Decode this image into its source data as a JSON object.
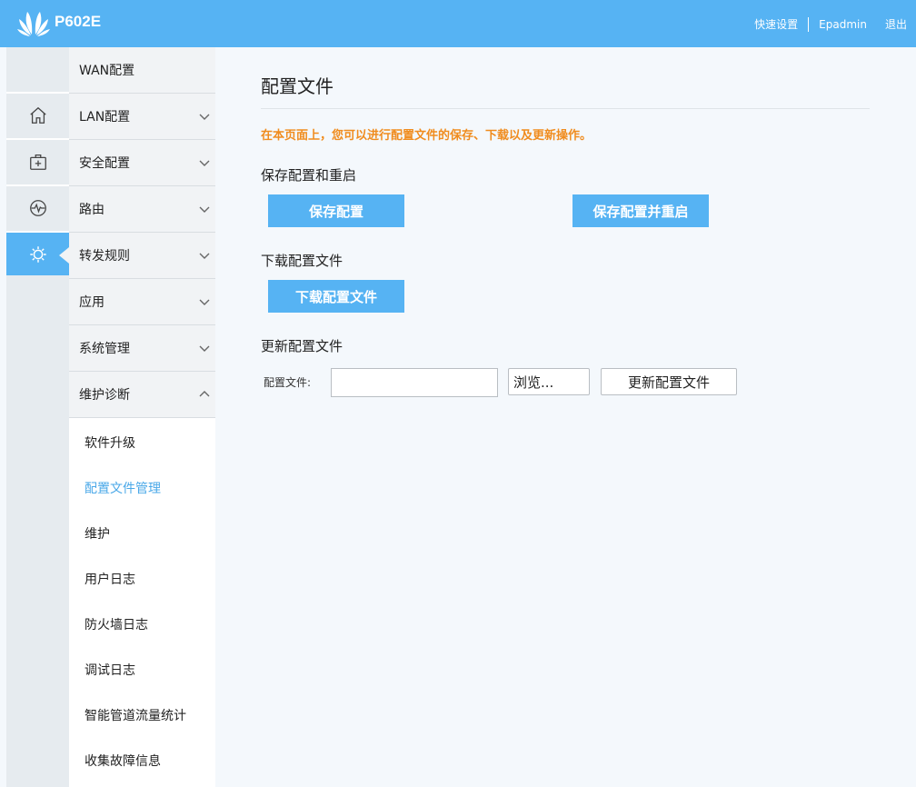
{
  "header": {
    "brand": "P602E",
    "quick_setup": "快速设置",
    "user": "Epadmin",
    "logout": "退出",
    "bg_color": "#56b3f3"
  },
  "rail": {
    "icons": [
      "home-icon",
      "first-aid-icon",
      "pulse-icon",
      "gear-icon"
    ],
    "active_index": 3
  },
  "menu": {
    "items": [
      {
        "label": "WAN配置",
        "chevron": "none"
      },
      {
        "label": "LAN配置",
        "chevron": "down"
      },
      {
        "label": "安全配置",
        "chevron": "down"
      },
      {
        "label": "路由",
        "chevron": "down"
      },
      {
        "label": "转发规则",
        "chevron": "down"
      },
      {
        "label": "应用",
        "chevron": "down"
      },
      {
        "label": "系统管理",
        "chevron": "down"
      },
      {
        "label": "维护诊断",
        "chevron": "up"
      }
    ],
    "submenu": [
      {
        "label": "软件升级"
      },
      {
        "label": "配置文件管理",
        "active": true
      },
      {
        "label": "维护"
      },
      {
        "label": "用户日志"
      },
      {
        "label": "防火墙日志"
      },
      {
        "label": "调试日志"
      },
      {
        "label": "智能管道流量统计"
      },
      {
        "label": "收集故障信息"
      }
    ]
  },
  "main": {
    "title": "配置文件",
    "notice": "在本页面上，您可以进行配置文件的保存、下载以及更新操作。",
    "notice_color": "#f08c1e",
    "save_section": {
      "title": "保存配置和重启",
      "save_button": "保存配置",
      "save_reboot_button": "保存配置并重启"
    },
    "download_section": {
      "title": "下载配置文件",
      "download_button": "下载配置文件"
    },
    "update_section": {
      "title": "更新配置文件",
      "file_label": "配置文件:",
      "file_value": "",
      "browse_button": "浏览...",
      "update_button": "更新配置文件"
    }
  }
}
